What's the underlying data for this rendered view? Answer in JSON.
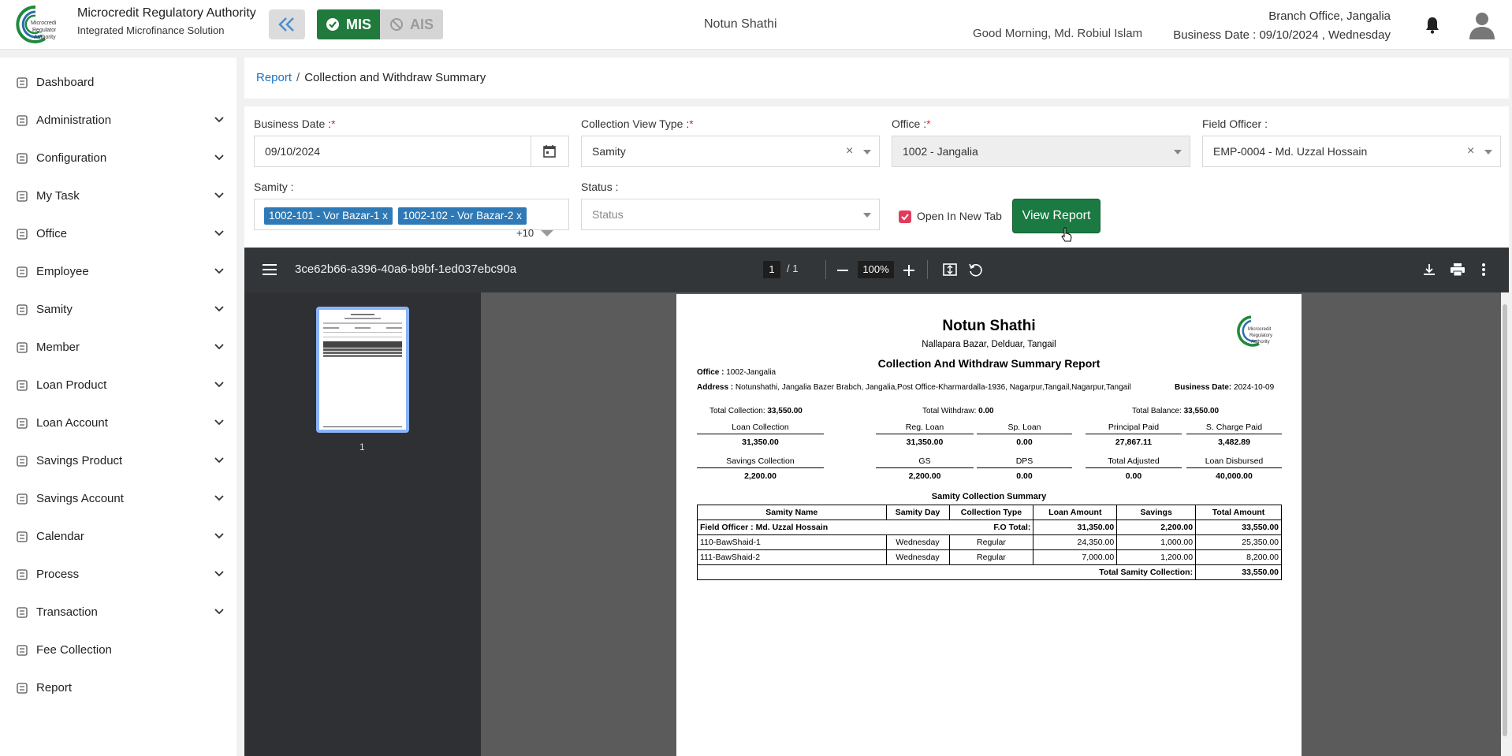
{
  "header": {
    "brand_title": "Microcredit Regulatory Authority",
    "brand_subtitle": "Integrated Microfinance Solution",
    "logo_text": "Microcredit Regulatory Authority",
    "mis_label": "MIS",
    "ais_label": "AIS",
    "org_name": "Notun Shathi",
    "greeting": "Good Morning, Md. Robiul Islam",
    "branch": "Branch Office, Jangalia",
    "business_date": "Business Date : 09/10/2024 , Wednesday"
  },
  "sidebar": {
    "items": [
      {
        "label": "Dashboard",
        "icon": "dashboard-icon",
        "expandable": false
      },
      {
        "label": "Administration",
        "icon": "admin-icon",
        "expandable": true
      },
      {
        "label": "Configuration",
        "icon": "sliders-icon",
        "expandable": true
      },
      {
        "label": "My Task",
        "icon": "task-icon",
        "expandable": true
      },
      {
        "label": "Office",
        "icon": "office-icon",
        "expandable": true
      },
      {
        "label": "Employee",
        "icon": "employee-icon",
        "expandable": true
      },
      {
        "label": "Samity",
        "icon": "samity-icon",
        "expandable": true
      },
      {
        "label": "Member",
        "icon": "member-icon",
        "expandable": true
      },
      {
        "label": "Loan Product",
        "icon": "loan-product-icon",
        "expandable": true
      },
      {
        "label": "Loan Account",
        "icon": "loan-account-icon",
        "expandable": true
      },
      {
        "label": "Savings Product",
        "icon": "savings-product-icon",
        "expandable": true
      },
      {
        "label": "Savings Account",
        "icon": "savings-account-icon",
        "expandable": true
      },
      {
        "label": "Calendar",
        "icon": "calendar-icon",
        "expandable": true
      },
      {
        "label": "Process",
        "icon": "process-icon",
        "expandable": true
      },
      {
        "label": "Transaction",
        "icon": "transaction-icon",
        "expandable": true
      },
      {
        "label": "Fee Collection",
        "icon": "fee-icon",
        "expandable": false
      },
      {
        "label": "Report",
        "icon": "report-icon",
        "expandable": false
      }
    ]
  },
  "breadcrumb": {
    "root": "Report",
    "sep": "/",
    "current": "Collection and Withdraw Summary"
  },
  "form": {
    "business_date_label": "Business Date :",
    "business_date_value": "09/10/2024",
    "view_type_label": "Collection View Type :",
    "view_type_value": "Samity",
    "office_label": "Office :",
    "office_value": "1002 - Jangalia",
    "field_officer_label": "Field Officer :",
    "field_officer_value": "EMP-0004 - Md. Uzzal Hossain",
    "samity_label": "Samity :",
    "samity_tags": [
      "1002-101 - Vor Bazar-1",
      "1002-102 - Vor Bazar-2"
    ],
    "samity_more": "+10",
    "status_label": "Status :",
    "status_placeholder": "Status",
    "open_new_tab_label": "Open In New Tab",
    "open_new_tab_checked": true,
    "view_report_label": "View Report",
    "required_mark": "*"
  },
  "viewer": {
    "doc_name": "3ce62b66-a396-40a6-b9bf-1ed037ebc90a",
    "page_current": "1",
    "page_total": "/ 1",
    "zoom": "100%",
    "thumb_page": "1"
  },
  "report": {
    "org": "Notun Shathi",
    "address_line": "Nallapara Bazar, Delduar, Tangail",
    "title": "Collection And Withdraw Summary Report",
    "office_label": "Office :",
    "office_value": "1002-Jangalia",
    "address_label": "Address :",
    "address_value": "Notunshathi, Jangalia Bazer Brabch, Jangalia,Post Office-Kharmardalla-1936, Nagarpur,Tangail,Nagarpur,Tangail",
    "bdate_label": "Business Date:",
    "bdate_value": "2024-10-09",
    "total_collection_label": "Total Collection:",
    "total_collection": "33,550.00",
    "total_withdraw_label": "Total Withdraw:",
    "total_withdraw": "0.00",
    "total_balance_label": "Total Balance:",
    "total_balance": "33,550.00",
    "stats_row1": [
      {
        "label": "Loan Collection",
        "value": "31,350.00"
      },
      {
        "label": "Reg. Loan",
        "value": "31,350.00"
      },
      {
        "label": "Sp. Loan",
        "value": "0.00"
      },
      {
        "label": "Principal Paid",
        "value": "27,867.11"
      },
      {
        "label": "S. Charge Paid",
        "value": "3,482.89"
      }
    ],
    "stats_row2": [
      {
        "label": "Savings Collection",
        "value": "2,200.00"
      },
      {
        "label": "GS",
        "value": "2,200.00"
      },
      {
        "label": "DPS",
        "value": "0.00"
      },
      {
        "label": "Total Adjusted",
        "value": "0.00"
      },
      {
        "label": "Loan Disbursed",
        "value": "40,000.00"
      }
    ],
    "table_title": "Samity Collection Summary",
    "columns": [
      "Samity Name",
      "Samity Day",
      "Collection Type",
      "Loan Amount",
      "Savings",
      "Total Amount"
    ],
    "fo_row": {
      "label": "Field Officer : Md. Uzzal Hossain",
      "total_label": "F.O Total:",
      "loan": "31,350.00",
      "savings": "2,200.00",
      "total": "33,550.00"
    },
    "rows": [
      {
        "name": "110-BawShaid-1",
        "day": "Wednesday",
        "type": "Regular",
        "loan": "24,350.00",
        "savings": "1,000.00",
        "total": "25,350.00"
      },
      {
        "name": "111-BawShaid-2",
        "day": "Wednesday",
        "type": "Regular",
        "loan": "7,000.00",
        "savings": "1,200.00",
        "total": "8,200.00"
      }
    ],
    "grand_label": "Total Samity Collection:",
    "grand_total": "33,550.00"
  }
}
